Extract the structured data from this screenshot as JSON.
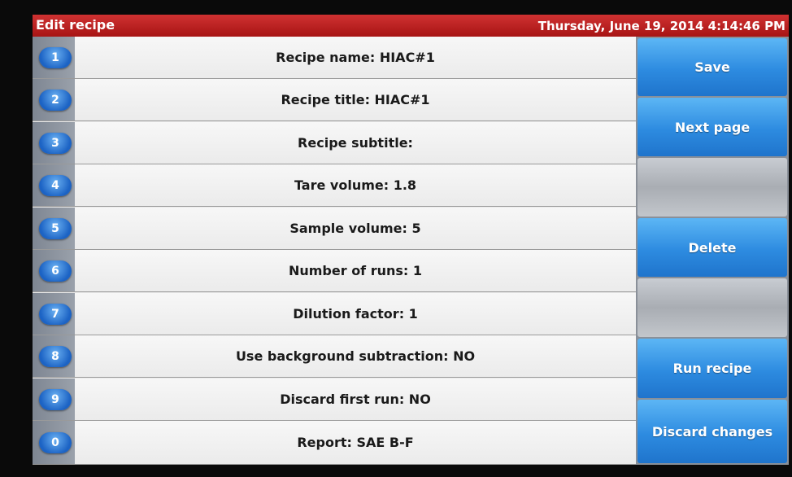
{
  "header": {
    "title": "Edit recipe",
    "datetime": "Thursday, June 19, 2014 4:14:46 PM"
  },
  "fields": [
    {
      "num": "1",
      "label": "Recipe name: HIAC#1"
    },
    {
      "num": "2",
      "label": "Recipe title: HIAC#1"
    },
    {
      "num": "3",
      "label": "Recipe subtitle:"
    },
    {
      "num": "4",
      "label": "Tare volume: 1.8"
    },
    {
      "num": "5",
      "label": "Sample volume: 5"
    },
    {
      "num": "6",
      "label": "Number of runs: 1"
    },
    {
      "num": "7",
      "label": "Dilution factor: 1"
    },
    {
      "num": "8",
      "label": "Use background subtraction: NO"
    },
    {
      "num": "9",
      "label": "Discard first run: NO"
    },
    {
      "num": "0",
      "label": "Report: SAE B-F"
    }
  ],
  "buttons": {
    "save": "Save",
    "next_page": "Next page",
    "blank1": "",
    "delete": "Delete",
    "blank2": "",
    "run_recipe": "Run recipe",
    "discard_changes": "Discard changes"
  },
  "colors": {
    "header_red": "#b81e1e",
    "button_blue": "#2d8be0",
    "number_blue": "#1c63c4"
  }
}
